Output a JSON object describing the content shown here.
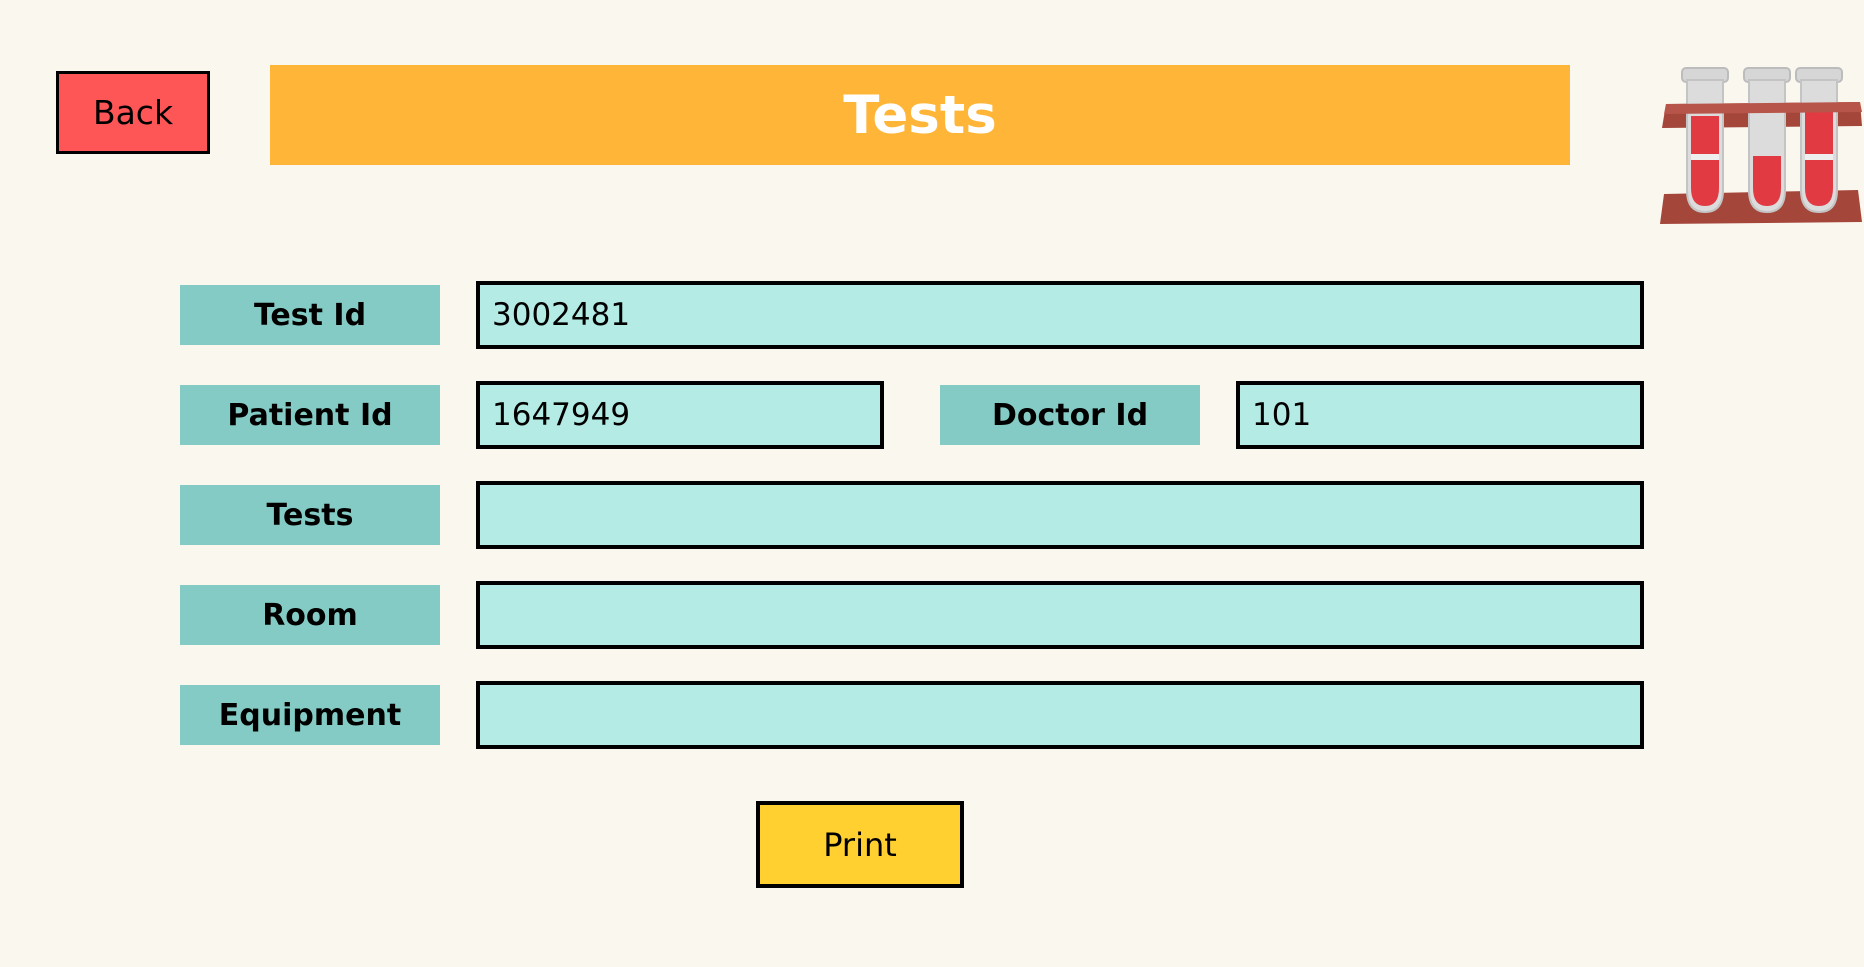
{
  "header": {
    "back_label": "Back",
    "title": "Tests"
  },
  "form": {
    "test_id": {
      "label": "Test Id",
      "value": "3002481"
    },
    "patient_id": {
      "label": "Patient Id",
      "value": "1647949"
    },
    "doctor_id": {
      "label": "Doctor Id",
      "value": "101"
    },
    "tests": {
      "label": "Tests",
      "value": ""
    },
    "room": {
      "label": "Room",
      "value": ""
    },
    "equipment": {
      "label": "Equipment",
      "value": ""
    }
  },
  "actions": {
    "print_label": "Print"
  },
  "colors": {
    "background": "#faf7ef",
    "back_button": "#fe5557",
    "title_bar": "#ffb537",
    "label_bg": "#83cbc4",
    "field_bg": "#b4ebe4",
    "print_button": "#ffd02f"
  },
  "icons": {
    "header_illustration": "test-tube-rack-icon"
  }
}
